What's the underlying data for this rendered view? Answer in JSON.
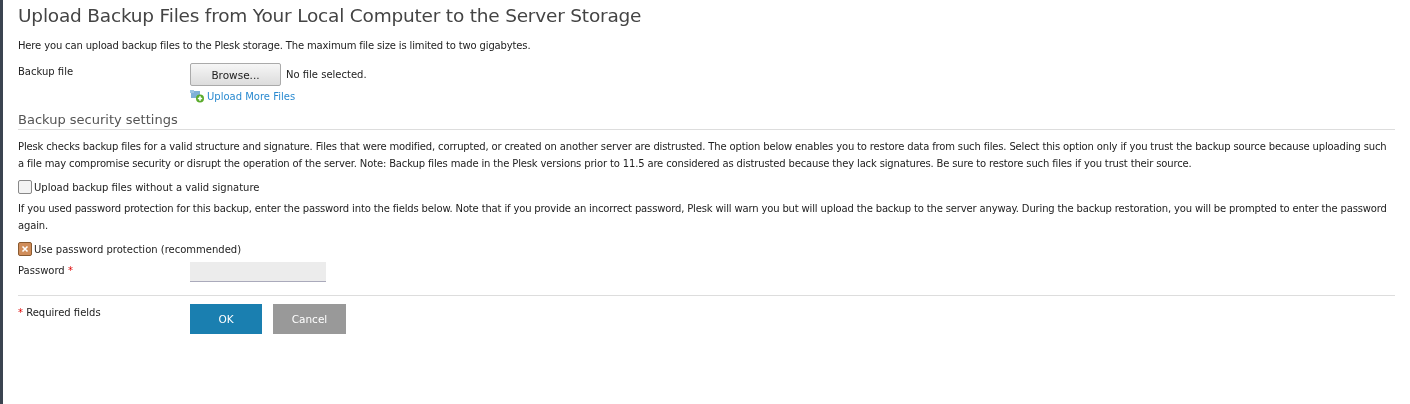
{
  "title": "Upload Backup Files from Your Local Computer to the Server Storage",
  "intro": "Here you can upload backup files to the Plesk storage. The maximum file size is limited to two gigabytes.",
  "backup_file": {
    "label": "Backup file",
    "button": "Browse...",
    "status": "No file selected.",
    "upload_more": "Upload More Files"
  },
  "security": {
    "heading": "Backup security settings",
    "description": "Plesk checks backup files for a valid structure and signature. Files that were modified, corrupted, or created on another server are distrusted. The option below enables you to restore data from such files. Select this option only if you trust the backup source because uploading such a file may compromise security or disrupt the operation of the server. Note: Backup files made in the Plesk versions prior to 11.5 are considered as distrusted because they lack signatures. Be sure to restore such files if you trust their source.",
    "unsigned_option": {
      "label": "Upload backup files without a valid signature",
      "checked": false
    },
    "password_note": "If you used password protection for this backup, enter the password into the fields below. Note that if you provide an incorrect password, Plesk will warn you but will upload the backup to the server anyway. During the backup restoration, you will be prompted to enter the password again.",
    "password_option": {
      "label": "Use password protection (recommended)",
      "checked": true
    },
    "password": {
      "label": "Password",
      "required_mark": "*"
    }
  },
  "footer": {
    "required_mark": "*",
    "required_text": "Required fields",
    "buttons": [
      {
        "label": "OK",
        "kind": "primary"
      },
      {
        "label": "Cancel",
        "kind": "secondary"
      }
    ]
  }
}
